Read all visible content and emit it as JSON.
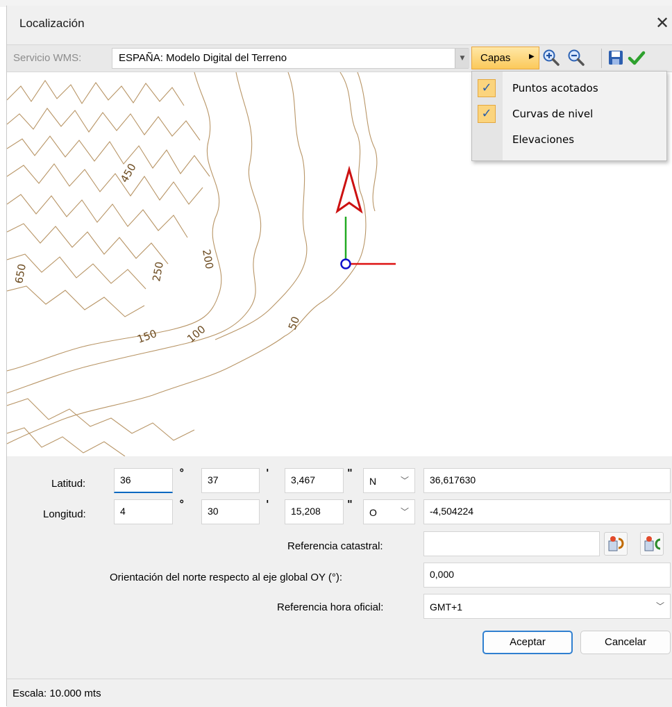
{
  "window": {
    "title": "Localización",
    "close_glyph": "✕"
  },
  "toolbar": {
    "wms_label": "Servicio WMS:",
    "wms_value": "ESPAÑA: Modelo Digital del Terreno",
    "capas_label": "Capas",
    "icons": [
      "zoom-in-icon",
      "zoom-out-icon",
      "save-icon",
      "accept-check-icon"
    ]
  },
  "capas_menu": {
    "items": [
      {
        "label": "Puntos acotados",
        "checked": true
      },
      {
        "label": "Curvas de nivel",
        "checked": true
      },
      {
        "label": "Elevaciones",
        "checked": false
      }
    ]
  },
  "map": {
    "contour_labels": [
      "450",
      "650",
      "250",
      "200",
      "150",
      "100",
      "50"
    ],
    "colors": {
      "contour": "#b89566",
      "north_arrow": "#cc1111",
      "y_axis": "#22aa22",
      "x_axis": "#dd1111",
      "origin": "#1010cc"
    }
  },
  "coords": {
    "latitude": {
      "label": "Latitud:",
      "deg": "36",
      "min": "37",
      "sec": "3,467",
      "hemisphere": "N",
      "decimal": "36,617630"
    },
    "longitude": {
      "label": "Longitud:",
      "deg": "4",
      "min": "30",
      "sec": "15,208",
      "hemisphere": "O",
      "decimal": "-4,504224"
    },
    "deg_mark": "°",
    "min_mark": "'",
    "sec_mark": "\""
  },
  "cadastral": {
    "label": "Referencia catastral:",
    "value": ""
  },
  "north": {
    "label": "Orientación del norte respecto al eje global OY (°):",
    "value": "0,000"
  },
  "timezone": {
    "label": "Referencia hora oficial:",
    "value": "GMT+1"
  },
  "buttons": {
    "accept": "Aceptar",
    "cancel": "Cancelar"
  },
  "status": {
    "scale": "Escala: 10.000 mts"
  }
}
